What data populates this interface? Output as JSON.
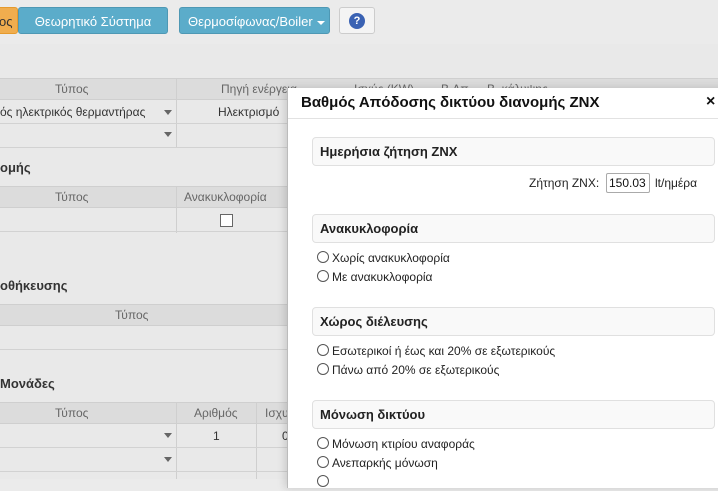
{
  "toolbar": {
    "left_button_partial": "ος",
    "system_button": "Θεωρητικό Σύστημα",
    "boiler_dropdown": "Θερμοσίφωνας/Boiler",
    "help_glyph": "?"
  },
  "background": {
    "table1": {
      "headers": [
        "Τύπος",
        "Πηγή ενέργεια",
        "Ισχύς (KW)",
        "Β.Απ",
        "Β. κάλυψης"
      ],
      "row1_type": "ός ηλεκτρικός θερμαντήρας",
      "row1_source": "Ηλεκτρισμό"
    },
    "section2": {
      "title": "ομής",
      "headers": [
        "Τύπος",
        "Ανακυκλοφορία"
      ]
    },
    "section3": {
      "title": "οθήκευσης",
      "headers": [
        "Τύπος"
      ]
    },
    "section4": {
      "title": "Μονάδες",
      "headers": [
        "Τύπος",
        "Αριθμός",
        "Ισχυ"
      ],
      "row1_count": "1",
      "row1_power_partial": "0"
    }
  },
  "modal": {
    "title": "Βαθμός Απόδοσης δικτύου διανομής ΖΝΧ",
    "close_glyph": "×",
    "daily_demand": {
      "title": "Ημερήσια ζήτηση ΖΝΧ",
      "label": "Ζήτηση ΖΝΧ:",
      "value": "150.03",
      "unit": "lt/ημέρα"
    },
    "recirculation": {
      "title": "Ανακυκλοφορία",
      "options": [
        "Χωρίς ανακυκλοφορία",
        "Με ανακυκλοφορία"
      ]
    },
    "passage_space": {
      "title": "Χώρος διέλευσης",
      "options": [
        "Εσωτερικοί ή έως και 20% σε εξωτερικούς",
        "Πάνω από 20% σε εξωτερικούς"
      ]
    },
    "insulation": {
      "title": "Μόνωση δικτύου",
      "options": [
        "Μόνωση κτιρίου αναφοράς",
        "Ανεπαρκής μόνωση"
      ]
    }
  }
}
